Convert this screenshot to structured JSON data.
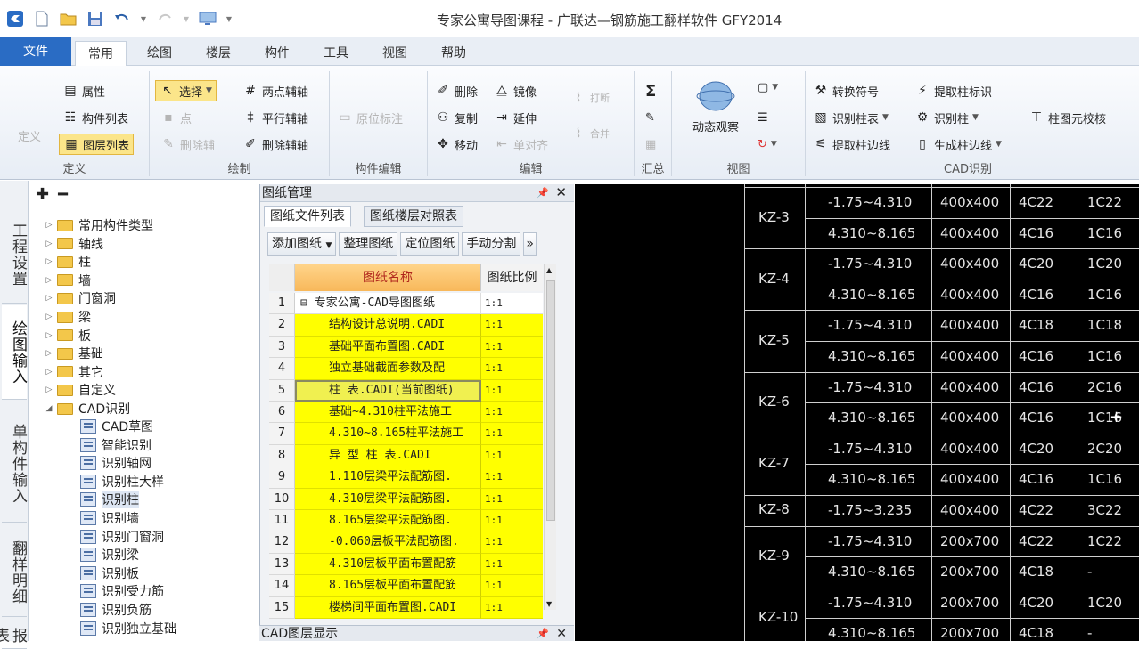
{
  "window": {
    "title": "专家公寓导图课程 - 广联达—钢筋施工翻样软件 GFY2014"
  },
  "tabs": {
    "file": "文件",
    "items": [
      "常用",
      "绘图",
      "楼层",
      "构件",
      "工具",
      "视图",
      "帮助"
    ]
  },
  "ribbon": {
    "define": {
      "label": "定义",
      "define_btn": "定义",
      "attr": "属性",
      "component_list": "构件列表",
      "layer_list": "图层列表"
    },
    "draw": {
      "label": "绘制",
      "select": "选择",
      "point": "点",
      "delete_aux": "删除辅",
      "two_point_axis": "两点辅轴",
      "parallel_axis": "平行辅轴",
      "delete_axis": "删除辅轴"
    },
    "comp_edit": {
      "label": "构件编辑",
      "relabel": "原位标注"
    },
    "edit": {
      "label": "编辑",
      "delete": "删除",
      "copy": "复制",
      "move": "移动",
      "mirror": "镜像",
      "extend": "延伸",
      "align": "单对齐",
      "break": "打断",
      "merge": "合并"
    },
    "summary": {
      "label": "汇总"
    },
    "view": {
      "label": "视图",
      "orbit": "动态观察"
    },
    "cad": {
      "label": "CAD识别",
      "convert_symbol": "转换符号",
      "identify_column_table": "识别柱表",
      "extract_column_edge": "提取柱边线",
      "extract_column_label": "提取柱标识",
      "identify_column": "识别柱",
      "generate_column_edge": "生成柱边线",
      "column_cell_check": "柱图元校核"
    }
  },
  "vtabs": [
    "工程设置",
    "绘图输入",
    "单构件输入",
    "翻样明细",
    "报表"
  ],
  "tree": {
    "folders": [
      "常用构件类型",
      "轴线",
      "柱",
      "墙",
      "门窗洞",
      "梁",
      "板",
      "基础",
      "其它",
      "自定义",
      "CAD识别"
    ],
    "cad_items": [
      "CAD草图",
      "智能识别",
      "识别轴网",
      "识别柱大样",
      "识别柱",
      "识别墙",
      "识别门窗洞",
      "识别梁",
      "识别板",
      "识别受力筋",
      "识别负筋",
      "识别独立基础"
    ]
  },
  "drawing_panel": {
    "title": "图纸管理",
    "tab1": "图纸文件列表",
    "tab2": "图纸楼层对照表",
    "buttons": [
      "添加图纸",
      "整理图纸",
      "定位图纸",
      "手动分割"
    ],
    "col_name": "图纸名称",
    "col_scale": "图纸比例",
    "rows": [
      {
        "no": "1",
        "name": "专家公寓-CAD导图图纸",
        "scale": "1:1"
      },
      {
        "no": "2",
        "name": "结构设计总说明.CADI",
        "scale": "1:1"
      },
      {
        "no": "3",
        "name": "基础平面布置图.CADI",
        "scale": "1:1"
      },
      {
        "no": "4",
        "name": "独立基础截面参数及配",
        "scale": "1:1"
      },
      {
        "no": "5",
        "name": "柱 表.CADI(当前图纸)",
        "scale": "1:1"
      },
      {
        "no": "6",
        "name": "基础~4.310柱平法施工",
        "scale": "1:1"
      },
      {
        "no": "7",
        "name": "4.310~8.165柱平法施工",
        "scale": "1:1"
      },
      {
        "no": "8",
        "name": "异 型 柱 表.CADI",
        "scale": "1:1"
      },
      {
        "no": "9",
        "name": "1.110层梁平法配筋图.",
        "scale": "1:1"
      },
      {
        "no": "10",
        "name": "4.310层梁平法配筋图.",
        "scale": "1:1"
      },
      {
        "no": "11",
        "name": "8.165层梁平法配筋图.",
        "scale": "1:1"
      },
      {
        "no": "12",
        "name": "-0.060层板平法配筋图.",
        "scale": "1:1"
      },
      {
        "no": "13",
        "name": "4.310层板平面布置配筋",
        "scale": "1:1"
      },
      {
        "no": "14",
        "name": "8.165层板平面布置配筋",
        "scale": "1:1"
      },
      {
        "no": "15",
        "name": "楼梯间平面布置图.CADI",
        "scale": "1:1"
      }
    ],
    "layer_panel_title": "CAD图层显示"
  },
  "cad_table": [
    {
      "id": "KZ-3",
      "rows": [
        [
          "-1.75~4.310",
          "400x400",
          "4C22",
          "1C22"
        ],
        [
          "4.310~8.165",
          "400x400",
          "4C16",
          "1C16"
        ]
      ]
    },
    {
      "id": "KZ-4",
      "rows": [
        [
          "-1.75~4.310",
          "400x400",
          "4C20",
          "1C20"
        ],
        [
          "4.310~8.165",
          "400x400",
          "4C16",
          "1C16"
        ]
      ]
    },
    {
      "id": "KZ-5",
      "rows": [
        [
          "-1.75~4.310",
          "400x400",
          "4C18",
          "1C18"
        ],
        [
          "4.310~8.165",
          "400x400",
          "4C16",
          "1C16"
        ]
      ]
    },
    {
      "id": "KZ-6",
      "rows": [
        [
          "-1.75~4.310",
          "400x400",
          "4C16",
          "2C16"
        ],
        [
          "4.310~8.165",
          "400x400",
          "4C16",
          "1C16"
        ]
      ]
    },
    {
      "id": "KZ-7",
      "rows": [
        [
          "-1.75~4.310",
          "400x400",
          "4C20",
          "2C20"
        ],
        [
          "4.310~8.165",
          "400x400",
          "4C16",
          "1C16"
        ]
      ]
    },
    {
      "id": "KZ-8",
      "rows": [
        [
          "-1.75~3.235",
          "400x400",
          "4C22",
          "3C22"
        ]
      ]
    },
    {
      "id": "KZ-9",
      "rows": [
        [
          "-1.75~4.310",
          "200x700",
          "4C22",
          "1C22"
        ],
        [
          "4.310~8.165",
          "200x700",
          "4C18",
          "-"
        ]
      ]
    },
    {
      "id": "KZ-10",
      "rows": [
        [
          "-1.75~4.310",
          "200x700",
          "4C20",
          "1C20"
        ],
        [
          "4.310~8.165",
          "200x700",
          "4C18",
          "-"
        ]
      ]
    }
  ]
}
